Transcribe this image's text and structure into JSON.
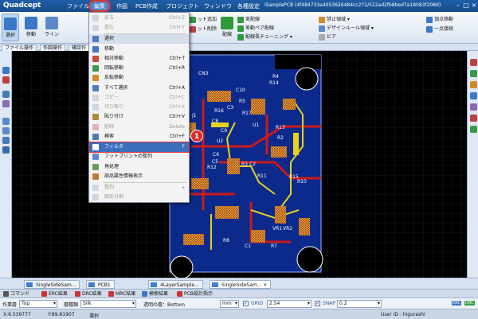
{
  "app": {
    "logo": "Quadcept",
    "window_title": "iSamplePCB (4f484733a4053626484cc272/512ad2fb8bed7a18083f208d)"
  },
  "menubar": {
    "items": [
      "ファイル",
      "編集",
      "作図",
      "PCB作成",
      "プロジェクト",
      "ウィンドウ",
      "各種設定"
    ],
    "active": "編集"
  },
  "ribbon": {
    "select_label": "選択",
    "move_label": "移動",
    "line_label": "ライン",
    "net_add_label": "ット追加",
    "net_delete_label": "ット削除",
    "wiring_label": "配線",
    "real_wiring_label": "実配線",
    "diff_pair_label": "差動ペア配線",
    "tuning_label": "配線長チューニング",
    "keepout_label": "禁止領域",
    "design_rule_label": "デザインルール領域",
    "via_label": "ビア",
    "point_move_label": "頂点移動",
    "one_point_label": "一点接続"
  },
  "panel_tabs": [
    "ファイル操作",
    "作図操作",
    "確認作"
  ],
  "edit_menu": {
    "items": [
      {
        "label": "戻る",
        "shortcut": "Ctrl+Z",
        "state": "disabled",
        "icon_color": "#8aa0c0"
      },
      {
        "label": "進む",
        "shortcut": "Ctrl+Y",
        "state": "disabled",
        "icon_color": "#8aa0c0"
      },
      {
        "label": "選択",
        "shortcut": "",
        "state": "selected",
        "icon_color": "#4c7cc2"
      },
      {
        "label": "移動",
        "shortcut": "",
        "state": "normal",
        "icon_color": "#3a78c8"
      },
      {
        "label": "相対移動",
        "shortcut": "Ctrl+T",
        "state": "normal",
        "icon_color": "#c84a3a"
      },
      {
        "label": "回転移動",
        "shortcut": "Ctrl+R",
        "state": "normal",
        "icon_color": "#3a9a4a"
      },
      {
        "label": "反転移動",
        "shortcut": "",
        "state": "normal",
        "icon_color": "#d08a2a"
      },
      {
        "label": "すべて選択",
        "shortcut": "Ctrl+A",
        "state": "normal",
        "icon_color": "#4c7cc2"
      },
      {
        "label": "コピー",
        "shortcut": "Ctrl+C",
        "state": "disabled",
        "icon_color": "#8aa0c0"
      },
      {
        "label": "切り取り",
        "shortcut": "Ctrl+X",
        "state": "disabled",
        "icon_color": "#8aa0c0"
      },
      {
        "label": "貼り付け",
        "shortcut": "Ctrl+V",
        "state": "normal",
        "icon_color": "#b08a3a"
      },
      {
        "label": "削除",
        "shortcut": "Delete",
        "state": "disabled",
        "icon_color": "#c04040"
      },
      {
        "label": "検索",
        "shortcut": "Ctrl+F",
        "state": "normal",
        "icon_color": "#4a7ab8"
      },
      {
        "label": "フィルタ",
        "shortcut": "F",
        "state": "highlighted",
        "icon_color": "#ffffff"
      },
      {
        "label": "フットプリントの整列",
        "shortcut": "",
        "state": "normal",
        "icon_color": "#5a8ac8"
      },
      {
        "label": "角処理",
        "shortcut": "",
        "state": "normal",
        "icon_color": "#6a9a5a"
      },
      {
        "label": "部品属性情報表示",
        "shortcut": "",
        "state": "normal",
        "icon_color": "#c07a3a"
      },
      {
        "label": "整列",
        "shortcut": "▸",
        "state": "disabled",
        "icon_color": "#8aa0c0"
      },
      {
        "label": "図形分割",
        "shortcut": "",
        "state": "disabled",
        "icon_color": "#8aa0c0"
      }
    ]
  },
  "callout": {
    "number": "1"
  },
  "pcb": {
    "refs": [
      "CN3",
      "R14",
      "R4",
      "C10",
      "R5",
      "C3",
      "U1",
      "R17",
      "R16",
      "C8",
      "C9",
      "R13",
      "R2",
      "J1",
      "U2",
      "C6",
      "C5",
      "R12",
      "R3",
      "C2",
      "R11",
      "R15",
      "R10",
      "VR1",
      "VR2",
      "R8",
      "C1",
      "R7"
    ]
  },
  "doc_tabs": [
    "SingleSideSam...",
    "PCB1",
    "4LayerSample...",
    "SingleSideSam..."
  ],
  "panels": [
    "コマンド",
    "ERC結果",
    "DRC結果",
    "MRC結果",
    "検索結果",
    "PCB設計指示"
  ],
  "props": {
    "layer_label": "作業層",
    "layer_value": "Top",
    "kind_label": "層種類",
    "kind_value": "Silk",
    "mode_text": "透明の層：Bottom",
    "unit_value": "mm",
    "grid_label": "GRID",
    "grid_value": "2.54",
    "snap_label": "SNAP",
    "snap_value": "0.2",
    "erc_label": "ERC",
    "drc_label": "DRC"
  },
  "status": {
    "x": "X:6.539777",
    "y": "Y:89.81907",
    "mode": "選択",
    "user": "User ID : higurashi"
  },
  "colors": {
    "title_bar": "#1f5fa8",
    "board": "#0b2a8c",
    "silk": "#ffffff",
    "track_red": "#cc1a1a",
    "track_yellow": "#e6d21c",
    "highlight_red": "#e23030"
  }
}
